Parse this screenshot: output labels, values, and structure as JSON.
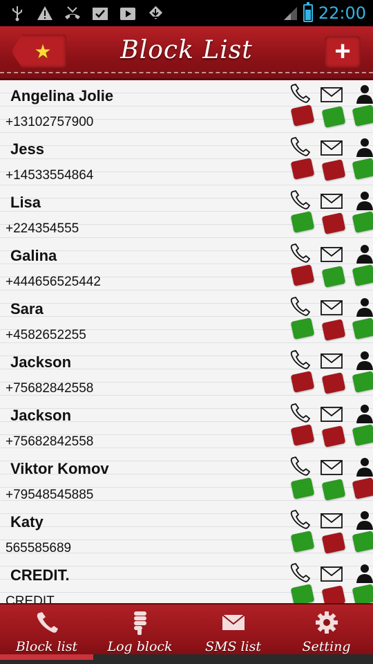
{
  "status_bar": {
    "time": "22:00"
  },
  "header": {
    "title": "Block List",
    "add_label": "+"
  },
  "contacts": [
    {
      "name": "Angelina Jolie",
      "phone": "+13102757900",
      "call": "red",
      "sms": "green",
      "contact": "green"
    },
    {
      "name": "Jess",
      "phone": "+14533554864",
      "call": "red",
      "sms": "red",
      "contact": "green"
    },
    {
      "name": "Lisa",
      "phone": "+224354555",
      "call": "green",
      "sms": "red",
      "contact": "green"
    },
    {
      "name": "Galina",
      "phone": "+444656525442",
      "call": "red",
      "sms": "green",
      "contact": "green"
    },
    {
      "name": "Sara",
      "phone": "+4582652255",
      "call": "green",
      "sms": "red",
      "contact": "green"
    },
    {
      "name": "Jackson",
      "phone": "+75682842558",
      "call": "red",
      "sms": "red",
      "contact": "green"
    },
    {
      "name": "Jackson",
      "phone": "+75682842558",
      "call": "red",
      "sms": "red",
      "contact": "green"
    },
    {
      "name": "Viktor Komov",
      "phone": "+79548545885",
      "call": "green",
      "sms": "green",
      "contact": "red"
    },
    {
      "name": "Katy",
      "phone": "565585689",
      "call": "green",
      "sms": "red",
      "contact": "green"
    },
    {
      "name": "CREDIT.",
      "phone": "CREDIT",
      "call": "green",
      "sms": "red",
      "contact": "green"
    }
  ],
  "bottom_nav": [
    {
      "label": "Block list",
      "icon": "phone-icon"
    },
    {
      "label": "Log block",
      "icon": "thumbs-down-icon"
    },
    {
      "label": "SMS list",
      "icon": "envelope-icon"
    },
    {
      "label": "Setting",
      "icon": "gear-icon"
    }
  ],
  "colors": {
    "accent": "#a3171c",
    "allowed": "#2a9a20",
    "blocked": "#a3171c",
    "clock": "#33b5e5"
  }
}
